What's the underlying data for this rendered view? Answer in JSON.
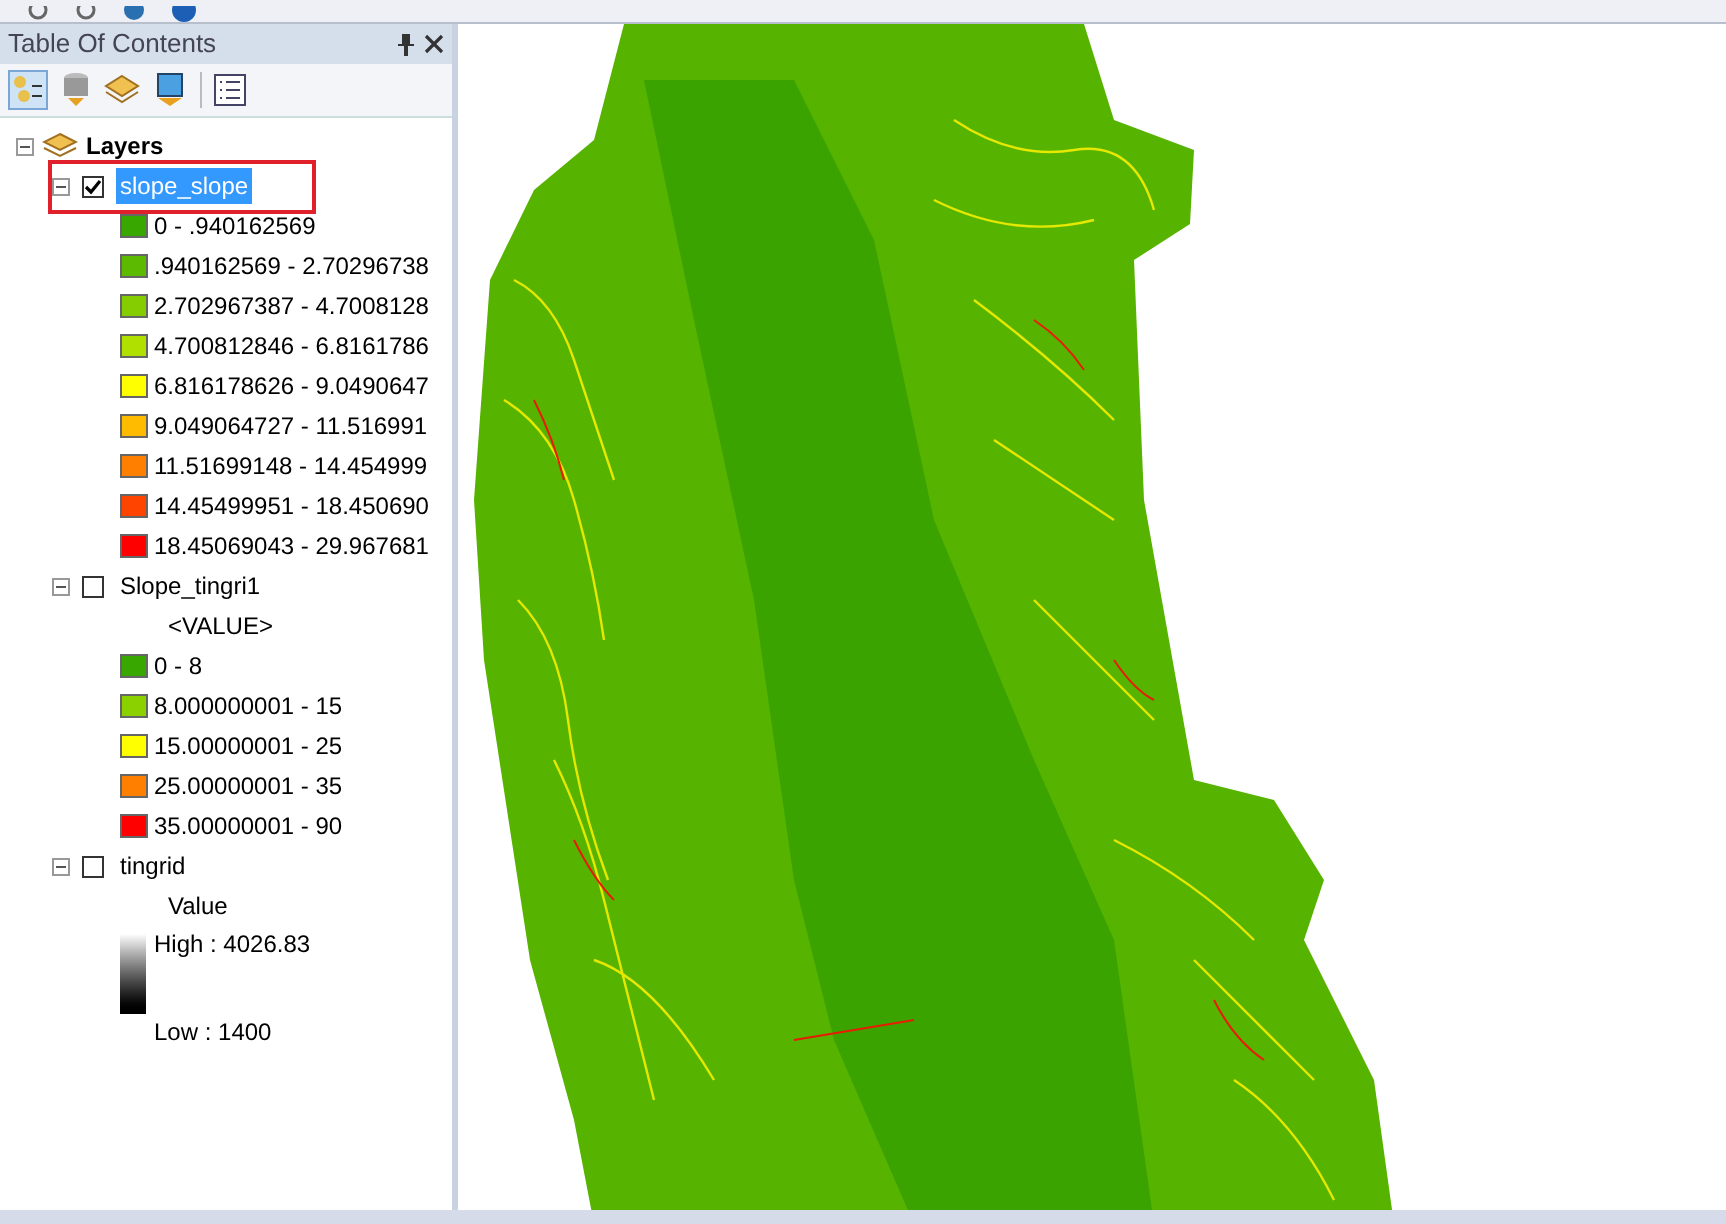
{
  "toc": {
    "title": "Table Of Contents",
    "root": {
      "label": "Layers",
      "expanded": true,
      "children": [
        {
          "label": "slope_slope",
          "checked": true,
          "selected": true,
          "expanded": true,
          "kind": "classes",
          "classes": [
            {
              "label": "0 - .940162569",
              "color": "#38a800"
            },
            {
              "label": ".940162569 - 2.70296738",
              "color": "#5cba00"
            },
            {
              "label": "2.702967387 - 4.7008128",
              "color": "#85cc00"
            },
            {
              "label": "4.700812846 - 6.8161786",
              "color": "#b0e000"
            },
            {
              "label": "6.816178626 - 9.0490647",
              "color": "#ffff00"
            },
            {
              "label": "9.049064727 - 11.516991",
              "color": "#ffbb00"
            },
            {
              "label": "11.51699148 - 14.454999",
              "color": "#ff8000"
            },
            {
              "label": "14.45499951 - 18.450690",
              "color": "#ff4400"
            },
            {
              "label": "18.45069043 - 29.967681",
              "color": "#ff0000"
            }
          ]
        },
        {
          "label": "Slope_tingri1",
          "checked": false,
          "selected": false,
          "expanded": true,
          "kind": "classes",
          "field": "<VALUE>",
          "classes": [
            {
              "label": "0 - 8",
              "color": "#38a800"
            },
            {
              "label": "8.000000001 - 15",
              "color": "#8bd100"
            },
            {
              "label": "15.00000001 - 25",
              "color": "#ffff00"
            },
            {
              "label": "25.00000001 - 35",
              "color": "#ff8000"
            },
            {
              "label": "35.00000001 - 90",
              "color": "#ff0000"
            }
          ]
        },
        {
          "label": "tingrid",
          "checked": false,
          "selected": false,
          "expanded": true,
          "kind": "stretched",
          "field": "Value",
          "high": "High : 4026.83",
          "low": "Low : 1400"
        }
      ]
    }
  }
}
